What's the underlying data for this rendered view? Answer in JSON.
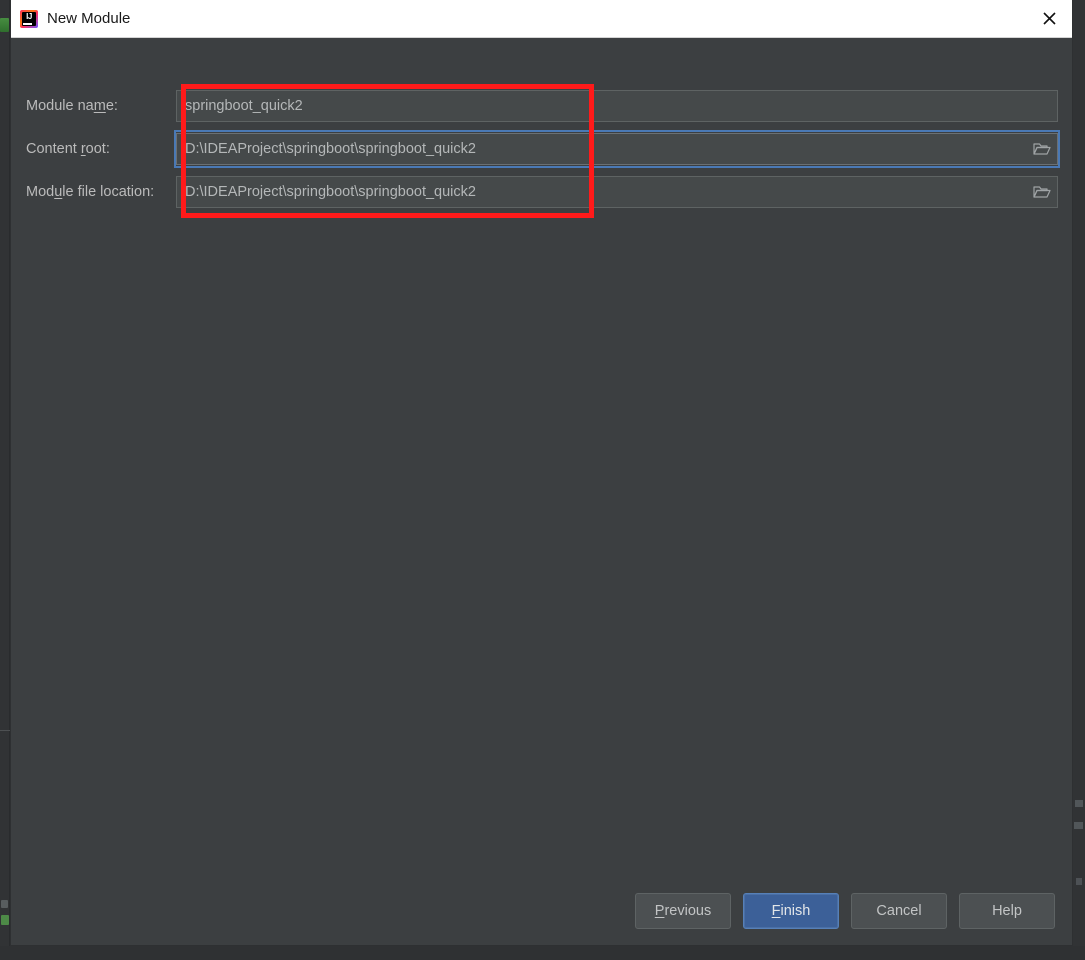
{
  "window": {
    "title": "New Module",
    "app_icon": "intellij-idea-icon",
    "close_icon": "close-icon"
  },
  "form": {
    "rows": [
      {
        "id": "module-name",
        "label_before": "Module na",
        "label_mnemonic": "m",
        "label_after": "e:",
        "value": "springboot_quick2",
        "has_browse": false,
        "focused": false
      },
      {
        "id": "content-root",
        "label_before": "Content ",
        "label_mnemonic": "r",
        "label_after": "oot:",
        "value": "D:\\IDEAProject\\springboot\\springboot_quick2",
        "has_browse": true,
        "browse_icon": "folder-browse-icon",
        "focused": true
      },
      {
        "id": "module-file-location",
        "label_before": "Mod",
        "label_mnemonic": "u",
        "label_after": "le file location:",
        "value": "D:\\IDEAProject\\springboot\\springboot_quick2",
        "has_browse": true,
        "browse_icon": "folder-browse-icon",
        "focused": false
      }
    ]
  },
  "annotation": {
    "shape": "rectangle",
    "color": "#ff1a1a",
    "note": "red highlight around the three path fields"
  },
  "buttons": [
    {
      "id": "previous",
      "before": "",
      "mnemonic": "P",
      "after": "revious",
      "default": false
    },
    {
      "id": "finish",
      "before": "",
      "mnemonic": "F",
      "after": "inish",
      "default": true
    },
    {
      "id": "cancel",
      "before": "Cancel",
      "mnemonic": "",
      "after": "",
      "default": false
    },
    {
      "id": "help",
      "before": "Help",
      "mnemonic": "",
      "after": "",
      "default": false
    }
  ],
  "colors": {
    "dialog_bg": "#3c3f41",
    "field_bg": "#45494a",
    "titlebar_bg": "#ffffff",
    "accent_blue": "#3c6098",
    "focus_blue": "#4a79b5",
    "annotation_red": "#ff1a1a",
    "text": "#bbbbbb"
  }
}
